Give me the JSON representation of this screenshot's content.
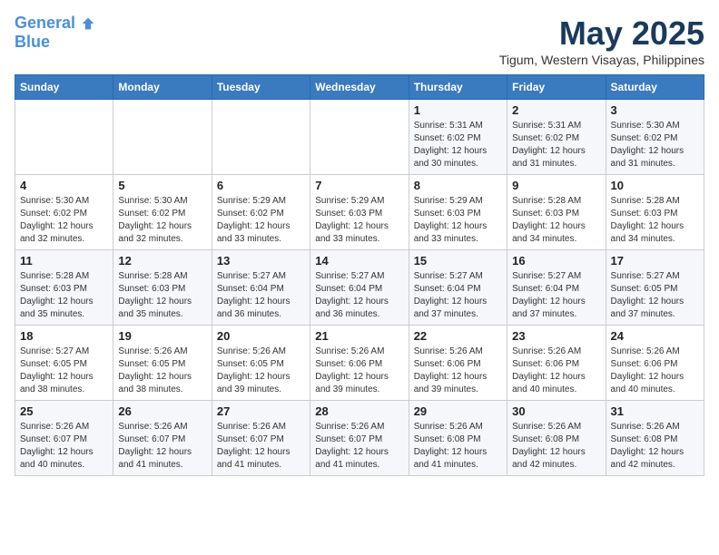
{
  "header": {
    "logo_line1": "General",
    "logo_line2": "Blue",
    "month": "May 2025",
    "location": "Tigum, Western Visayas, Philippines"
  },
  "weekdays": [
    "Sunday",
    "Monday",
    "Tuesday",
    "Wednesday",
    "Thursday",
    "Friday",
    "Saturday"
  ],
  "weeks": [
    [
      {
        "day": "",
        "info": ""
      },
      {
        "day": "",
        "info": ""
      },
      {
        "day": "",
        "info": ""
      },
      {
        "day": "",
        "info": ""
      },
      {
        "day": "1",
        "info": "Sunrise: 5:31 AM\nSunset: 6:02 PM\nDaylight: 12 hours\nand 30 minutes."
      },
      {
        "day": "2",
        "info": "Sunrise: 5:31 AM\nSunset: 6:02 PM\nDaylight: 12 hours\nand 31 minutes."
      },
      {
        "day": "3",
        "info": "Sunrise: 5:30 AM\nSunset: 6:02 PM\nDaylight: 12 hours\nand 31 minutes."
      }
    ],
    [
      {
        "day": "4",
        "info": "Sunrise: 5:30 AM\nSunset: 6:02 PM\nDaylight: 12 hours\nand 32 minutes."
      },
      {
        "day": "5",
        "info": "Sunrise: 5:30 AM\nSunset: 6:02 PM\nDaylight: 12 hours\nand 32 minutes."
      },
      {
        "day": "6",
        "info": "Sunrise: 5:29 AM\nSunset: 6:02 PM\nDaylight: 12 hours\nand 33 minutes."
      },
      {
        "day": "7",
        "info": "Sunrise: 5:29 AM\nSunset: 6:03 PM\nDaylight: 12 hours\nand 33 minutes."
      },
      {
        "day": "8",
        "info": "Sunrise: 5:29 AM\nSunset: 6:03 PM\nDaylight: 12 hours\nand 33 minutes."
      },
      {
        "day": "9",
        "info": "Sunrise: 5:28 AM\nSunset: 6:03 PM\nDaylight: 12 hours\nand 34 minutes."
      },
      {
        "day": "10",
        "info": "Sunrise: 5:28 AM\nSunset: 6:03 PM\nDaylight: 12 hours\nand 34 minutes."
      }
    ],
    [
      {
        "day": "11",
        "info": "Sunrise: 5:28 AM\nSunset: 6:03 PM\nDaylight: 12 hours\nand 35 minutes."
      },
      {
        "day": "12",
        "info": "Sunrise: 5:28 AM\nSunset: 6:03 PM\nDaylight: 12 hours\nand 35 minutes."
      },
      {
        "day": "13",
        "info": "Sunrise: 5:27 AM\nSunset: 6:04 PM\nDaylight: 12 hours\nand 36 minutes."
      },
      {
        "day": "14",
        "info": "Sunrise: 5:27 AM\nSunset: 6:04 PM\nDaylight: 12 hours\nand 36 minutes."
      },
      {
        "day": "15",
        "info": "Sunrise: 5:27 AM\nSunset: 6:04 PM\nDaylight: 12 hours\nand 37 minutes."
      },
      {
        "day": "16",
        "info": "Sunrise: 5:27 AM\nSunset: 6:04 PM\nDaylight: 12 hours\nand 37 minutes."
      },
      {
        "day": "17",
        "info": "Sunrise: 5:27 AM\nSunset: 6:05 PM\nDaylight: 12 hours\nand 37 minutes."
      }
    ],
    [
      {
        "day": "18",
        "info": "Sunrise: 5:27 AM\nSunset: 6:05 PM\nDaylight: 12 hours\nand 38 minutes."
      },
      {
        "day": "19",
        "info": "Sunrise: 5:26 AM\nSunset: 6:05 PM\nDaylight: 12 hours\nand 38 minutes."
      },
      {
        "day": "20",
        "info": "Sunrise: 5:26 AM\nSunset: 6:05 PM\nDaylight: 12 hours\nand 39 minutes."
      },
      {
        "day": "21",
        "info": "Sunrise: 5:26 AM\nSunset: 6:06 PM\nDaylight: 12 hours\nand 39 minutes."
      },
      {
        "day": "22",
        "info": "Sunrise: 5:26 AM\nSunset: 6:06 PM\nDaylight: 12 hours\nand 39 minutes."
      },
      {
        "day": "23",
        "info": "Sunrise: 5:26 AM\nSunset: 6:06 PM\nDaylight: 12 hours\nand 40 minutes."
      },
      {
        "day": "24",
        "info": "Sunrise: 5:26 AM\nSunset: 6:06 PM\nDaylight: 12 hours\nand 40 minutes."
      }
    ],
    [
      {
        "day": "25",
        "info": "Sunrise: 5:26 AM\nSunset: 6:07 PM\nDaylight: 12 hours\nand 40 minutes."
      },
      {
        "day": "26",
        "info": "Sunrise: 5:26 AM\nSunset: 6:07 PM\nDaylight: 12 hours\nand 41 minutes."
      },
      {
        "day": "27",
        "info": "Sunrise: 5:26 AM\nSunset: 6:07 PM\nDaylight: 12 hours\nand 41 minutes."
      },
      {
        "day": "28",
        "info": "Sunrise: 5:26 AM\nSunset: 6:07 PM\nDaylight: 12 hours\nand 41 minutes."
      },
      {
        "day": "29",
        "info": "Sunrise: 5:26 AM\nSunset: 6:08 PM\nDaylight: 12 hours\nand 41 minutes."
      },
      {
        "day": "30",
        "info": "Sunrise: 5:26 AM\nSunset: 6:08 PM\nDaylight: 12 hours\nand 42 minutes."
      },
      {
        "day": "31",
        "info": "Sunrise: 5:26 AM\nSunset: 6:08 PM\nDaylight: 12 hours\nand 42 minutes."
      }
    ]
  ]
}
